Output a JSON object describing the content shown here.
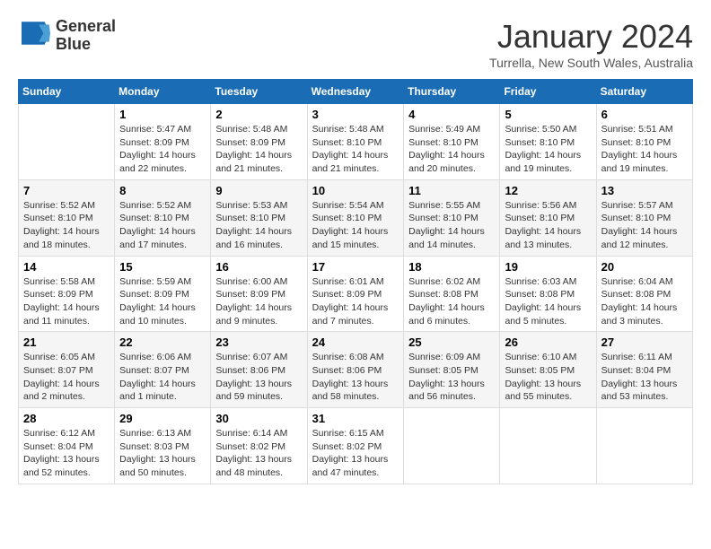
{
  "logo": {
    "line1": "General",
    "line2": "Blue"
  },
  "title": "January 2024",
  "subtitle": "Turrella, New South Wales, Australia",
  "days_header": [
    "Sunday",
    "Monday",
    "Tuesday",
    "Wednesday",
    "Thursday",
    "Friday",
    "Saturday"
  ],
  "weeks": [
    [
      {
        "num": "",
        "info": ""
      },
      {
        "num": "1",
        "info": "Sunrise: 5:47 AM\nSunset: 8:09 PM\nDaylight: 14 hours\nand 22 minutes."
      },
      {
        "num": "2",
        "info": "Sunrise: 5:48 AM\nSunset: 8:09 PM\nDaylight: 14 hours\nand 21 minutes."
      },
      {
        "num": "3",
        "info": "Sunrise: 5:48 AM\nSunset: 8:10 PM\nDaylight: 14 hours\nand 21 minutes."
      },
      {
        "num": "4",
        "info": "Sunrise: 5:49 AM\nSunset: 8:10 PM\nDaylight: 14 hours\nand 20 minutes."
      },
      {
        "num": "5",
        "info": "Sunrise: 5:50 AM\nSunset: 8:10 PM\nDaylight: 14 hours\nand 19 minutes."
      },
      {
        "num": "6",
        "info": "Sunrise: 5:51 AM\nSunset: 8:10 PM\nDaylight: 14 hours\nand 19 minutes."
      }
    ],
    [
      {
        "num": "7",
        "info": "Sunrise: 5:52 AM\nSunset: 8:10 PM\nDaylight: 14 hours\nand 18 minutes."
      },
      {
        "num": "8",
        "info": "Sunrise: 5:52 AM\nSunset: 8:10 PM\nDaylight: 14 hours\nand 17 minutes."
      },
      {
        "num": "9",
        "info": "Sunrise: 5:53 AM\nSunset: 8:10 PM\nDaylight: 14 hours\nand 16 minutes."
      },
      {
        "num": "10",
        "info": "Sunrise: 5:54 AM\nSunset: 8:10 PM\nDaylight: 14 hours\nand 15 minutes."
      },
      {
        "num": "11",
        "info": "Sunrise: 5:55 AM\nSunset: 8:10 PM\nDaylight: 14 hours\nand 14 minutes."
      },
      {
        "num": "12",
        "info": "Sunrise: 5:56 AM\nSunset: 8:10 PM\nDaylight: 14 hours\nand 13 minutes."
      },
      {
        "num": "13",
        "info": "Sunrise: 5:57 AM\nSunset: 8:10 PM\nDaylight: 14 hours\nand 12 minutes."
      }
    ],
    [
      {
        "num": "14",
        "info": "Sunrise: 5:58 AM\nSunset: 8:09 PM\nDaylight: 14 hours\nand 11 minutes."
      },
      {
        "num": "15",
        "info": "Sunrise: 5:59 AM\nSunset: 8:09 PM\nDaylight: 14 hours\nand 10 minutes."
      },
      {
        "num": "16",
        "info": "Sunrise: 6:00 AM\nSunset: 8:09 PM\nDaylight: 14 hours\nand 9 minutes."
      },
      {
        "num": "17",
        "info": "Sunrise: 6:01 AM\nSunset: 8:09 PM\nDaylight: 14 hours\nand 7 minutes."
      },
      {
        "num": "18",
        "info": "Sunrise: 6:02 AM\nSunset: 8:08 PM\nDaylight: 14 hours\nand 6 minutes."
      },
      {
        "num": "19",
        "info": "Sunrise: 6:03 AM\nSunset: 8:08 PM\nDaylight: 14 hours\nand 5 minutes."
      },
      {
        "num": "20",
        "info": "Sunrise: 6:04 AM\nSunset: 8:08 PM\nDaylight: 14 hours\nand 3 minutes."
      }
    ],
    [
      {
        "num": "21",
        "info": "Sunrise: 6:05 AM\nSunset: 8:07 PM\nDaylight: 14 hours\nand 2 minutes."
      },
      {
        "num": "22",
        "info": "Sunrise: 6:06 AM\nSunset: 8:07 PM\nDaylight: 14 hours\nand 1 minute."
      },
      {
        "num": "23",
        "info": "Sunrise: 6:07 AM\nSunset: 8:06 PM\nDaylight: 13 hours\nand 59 minutes."
      },
      {
        "num": "24",
        "info": "Sunrise: 6:08 AM\nSunset: 8:06 PM\nDaylight: 13 hours\nand 58 minutes."
      },
      {
        "num": "25",
        "info": "Sunrise: 6:09 AM\nSunset: 8:05 PM\nDaylight: 13 hours\nand 56 minutes."
      },
      {
        "num": "26",
        "info": "Sunrise: 6:10 AM\nSunset: 8:05 PM\nDaylight: 13 hours\nand 55 minutes."
      },
      {
        "num": "27",
        "info": "Sunrise: 6:11 AM\nSunset: 8:04 PM\nDaylight: 13 hours\nand 53 minutes."
      }
    ],
    [
      {
        "num": "28",
        "info": "Sunrise: 6:12 AM\nSunset: 8:04 PM\nDaylight: 13 hours\nand 52 minutes."
      },
      {
        "num": "29",
        "info": "Sunrise: 6:13 AM\nSunset: 8:03 PM\nDaylight: 13 hours\nand 50 minutes."
      },
      {
        "num": "30",
        "info": "Sunrise: 6:14 AM\nSunset: 8:02 PM\nDaylight: 13 hours\nand 48 minutes."
      },
      {
        "num": "31",
        "info": "Sunrise: 6:15 AM\nSunset: 8:02 PM\nDaylight: 13 hours\nand 47 minutes."
      },
      {
        "num": "",
        "info": ""
      },
      {
        "num": "",
        "info": ""
      },
      {
        "num": "",
        "info": ""
      }
    ]
  ]
}
